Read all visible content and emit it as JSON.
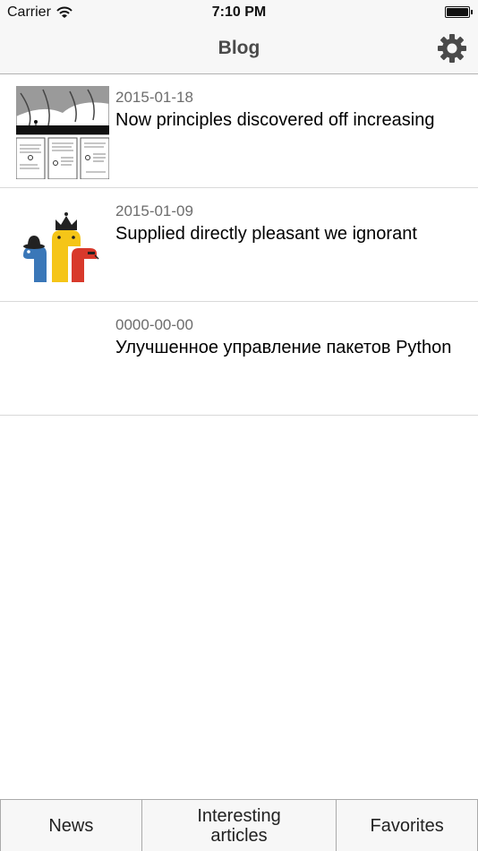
{
  "status_bar": {
    "carrier": "Carrier",
    "time": "7:10 PM"
  },
  "nav": {
    "title": "Blog",
    "settings_icon": "gear-icon"
  },
  "articles": [
    {
      "date": "2015-01-18",
      "title": "Now principles discovered off increasing",
      "thumbnail": "comic-strip-thumbnail"
    },
    {
      "date": "2015-01-09",
      "title": "Supplied directly pleasant we ignorant",
      "thumbnail": "python-snakes-logo"
    },
    {
      "date": "0000-00-00",
      "title": "Улучшенное управление пакетов Python",
      "thumbnail": ""
    }
  ],
  "tabs": [
    {
      "label": "News"
    },
    {
      "label": "Interesting articles"
    },
    {
      "label": "Favorites"
    }
  ],
  "colors": {
    "bar_bg": "#f7f7f7",
    "separator": "#d9d9d9",
    "title_gray": "#4a4a4a",
    "date_gray": "#6d6d6d"
  }
}
